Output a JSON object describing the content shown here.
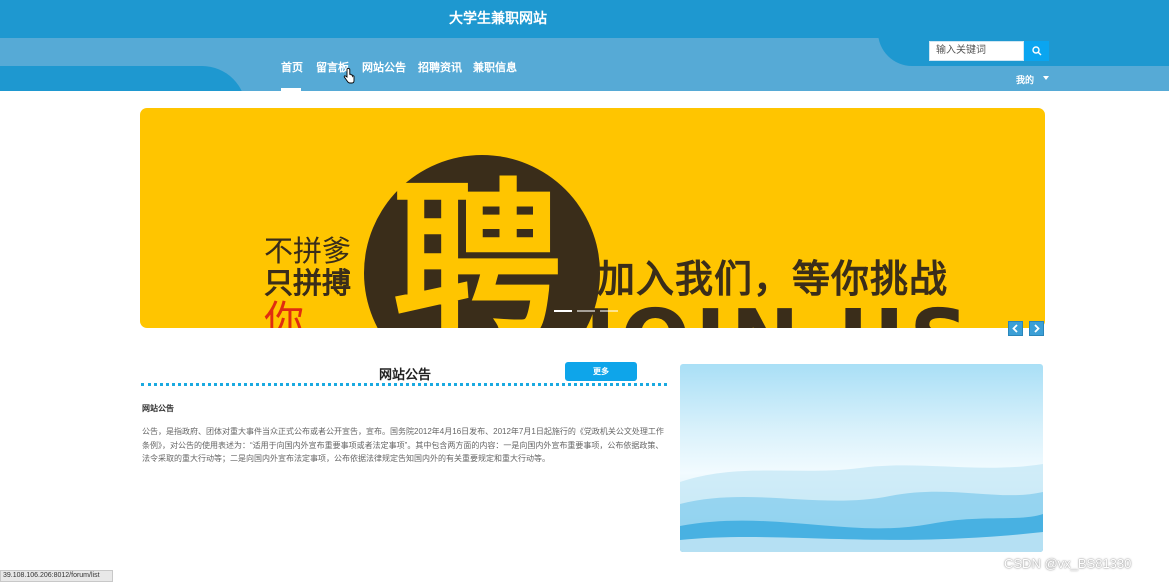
{
  "header": {
    "site_title": "大学生兼职网站"
  },
  "nav": {
    "items": [
      {
        "label": "首页",
        "active": true
      },
      {
        "label": "留言板",
        "active": false
      },
      {
        "label": "网站公告",
        "active": false
      },
      {
        "label": "招聘资讯",
        "active": false
      },
      {
        "label": "兼职信息",
        "active": false
      }
    ],
    "search": {
      "placeholder": "输入关键词",
      "icon": "search-icon"
    },
    "user_menu": {
      "label": "我的",
      "icon": "chevron-down-icon"
    }
  },
  "banner": {
    "text_line1": "不拼爹",
    "text_line2": "只拼搏",
    "text_line3": "你",
    "hire_char": "聘",
    "slogan": "加入我们，等你挑战",
    "join_text": "JOIN US",
    "slide_count": 3,
    "active_slide": 1,
    "colors": {
      "background": "#ffc500",
      "circle": "#3a2d1a",
      "accent": "#e02d10"
    }
  },
  "carousel_controls": {
    "prev_icon": "chevron-left-icon",
    "next_icon": "chevron-right-icon"
  },
  "notice": {
    "section_title": "网站公告",
    "more_label": "更多",
    "item_title": "网站公告",
    "item_body": "公告，是指政府、团体对重大事件当众正式公布或者公开宣告，宣布。国务院2012年4月16日发布、2012年7月1日起施行的《党政机关公文处理工作条例》，对公告的使用表述为：“适用于向国内外宣布重要事项或者法定事项”。其中包含两方面的内容：一是向国内外宣布重要事项，公布依据政策、法令采取的重大行动等；二是向国内外宣布法定事项，公布依据法律规定告知国内外的有关重要规定和重大行动等。"
  },
  "status_bar": {
    "url": "39.108.106.206:8012/forum/list"
  },
  "watermark": "CSDN @vx_BS81330",
  "theme": {
    "primary": "#1e98d0",
    "nav_bg": "#56aad6",
    "button": "#0ea5ea"
  }
}
